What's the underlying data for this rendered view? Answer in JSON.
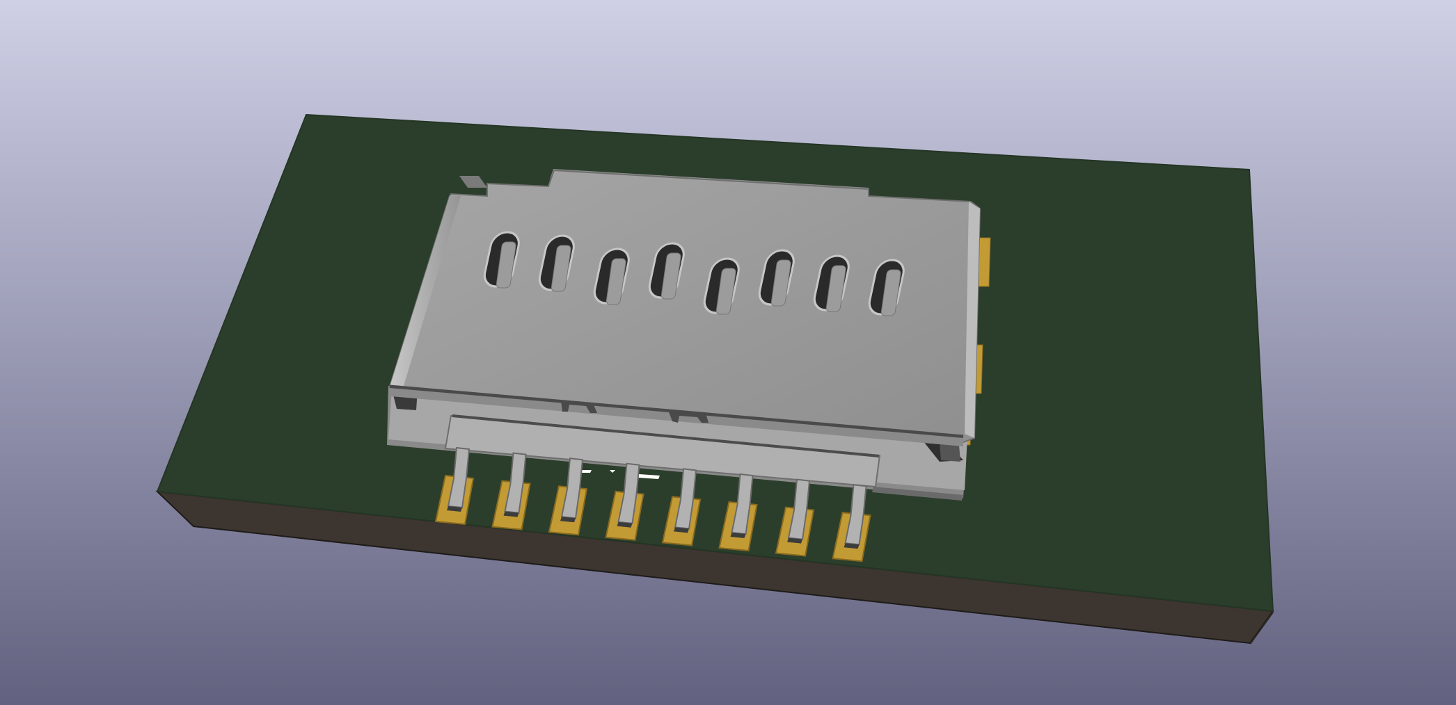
{
  "viewer": {
    "background": {
      "top": "#cfd0e6",
      "bottom": "#626280"
    },
    "board": {
      "top_color": "#2b3e2b",
      "edge_color": "#3c3530",
      "edge_outline": "#1e1b19"
    },
    "connector": {
      "shield_color": "#9a9a9a",
      "shield_light": "#b4b4b4",
      "shield_dark": "#5a5a5a",
      "body_color": "#a8a8a8",
      "slot_color": "#2a2a2a",
      "pin_count": 8
    },
    "pads": {
      "color": "#c39b35",
      "edge": "#8a6a1e"
    }
  }
}
